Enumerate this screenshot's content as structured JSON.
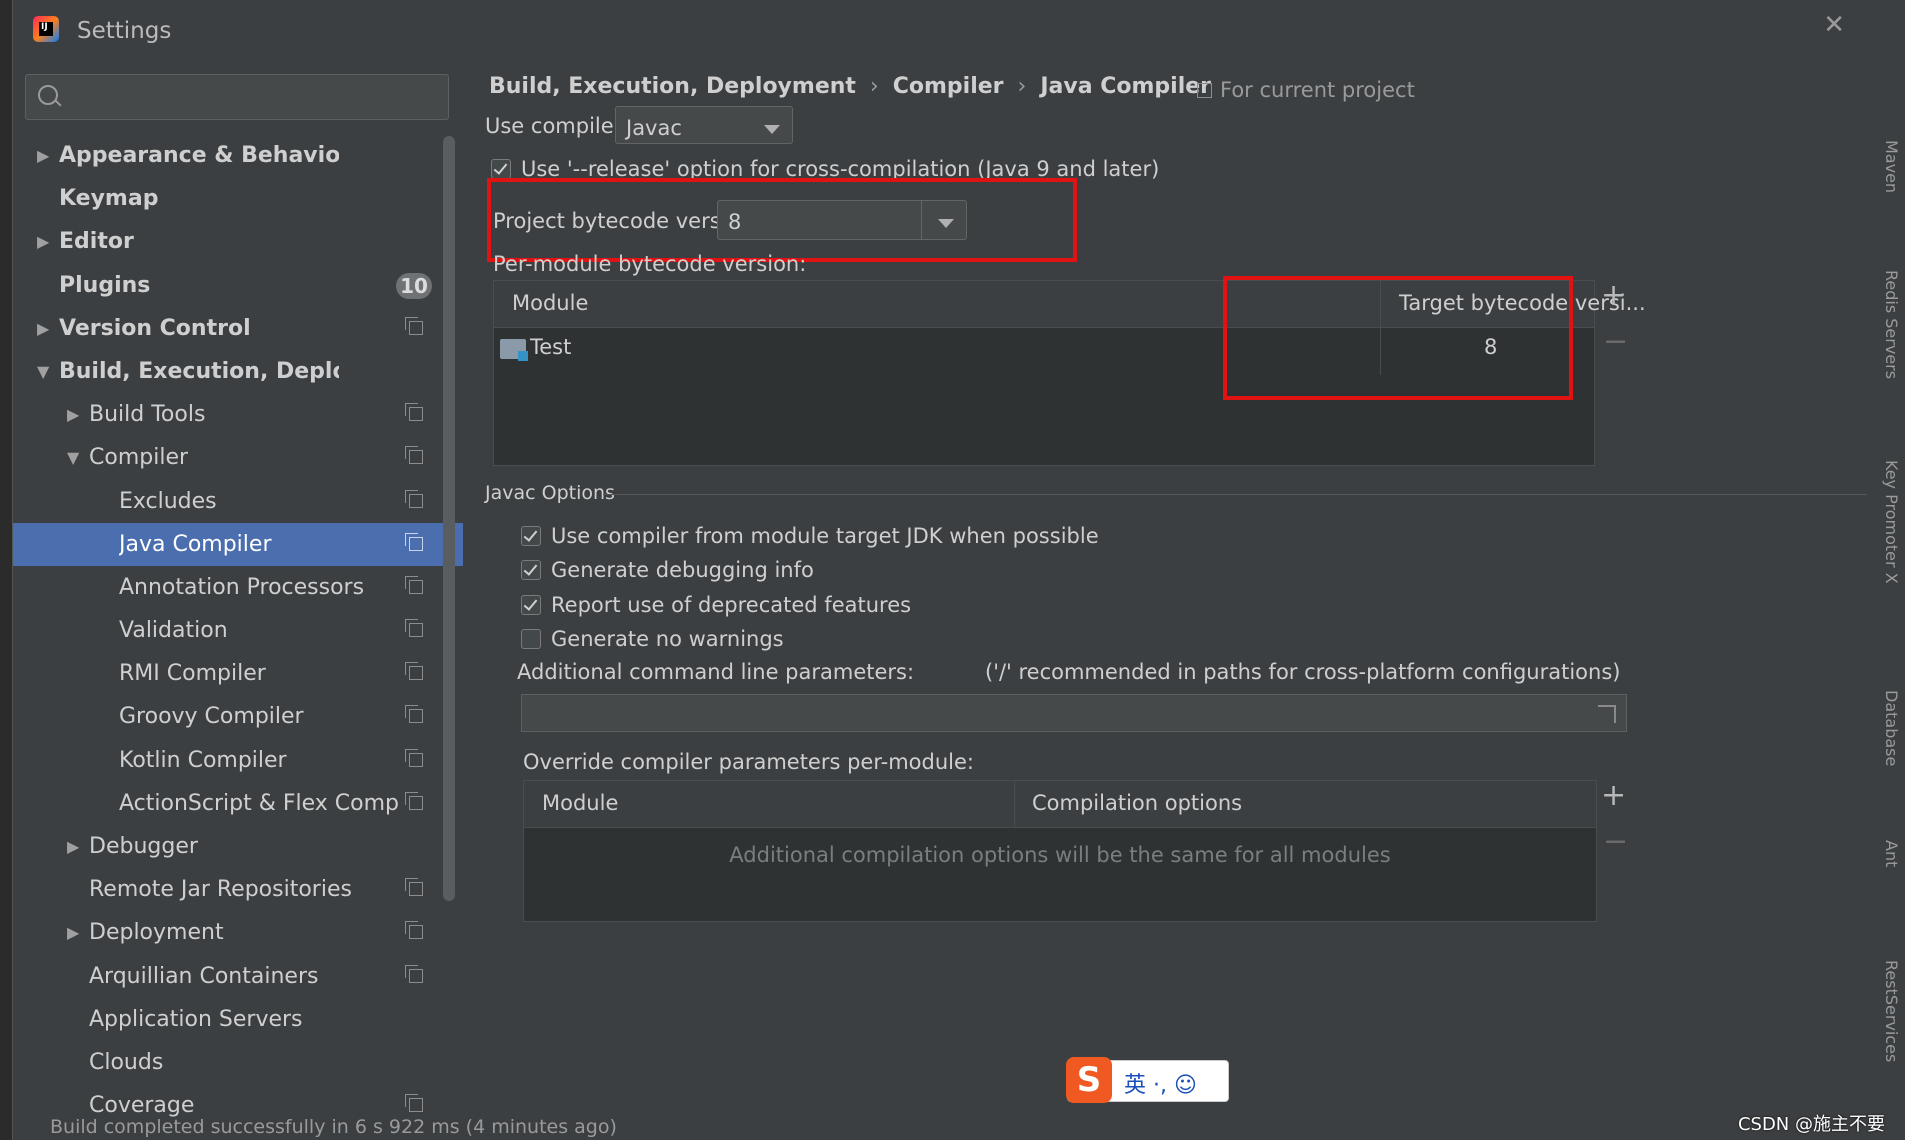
{
  "window": {
    "title": "Settings"
  },
  "search": {
    "placeholder": ""
  },
  "sidebar": {
    "items": [
      {
        "label": "Appearance & Behavior",
        "level": 0,
        "arrow": "collapsed",
        "bold": true
      },
      {
        "label": "Keymap",
        "level": 0,
        "arrow": "none",
        "bold": true
      },
      {
        "label": "Editor",
        "level": 0,
        "arrow": "collapsed",
        "bold": true
      },
      {
        "label": "Plugins",
        "level": 0,
        "arrow": "none",
        "bold": true,
        "badge": "10"
      },
      {
        "label": "Version Control",
        "level": 0,
        "arrow": "collapsed",
        "bold": true,
        "project": true
      },
      {
        "label": "Build, Execution, Deployment",
        "level": 0,
        "arrow": "expanded",
        "bold": true
      },
      {
        "label": "Build Tools",
        "level": 1,
        "arrow": "collapsed",
        "project": true
      },
      {
        "label": "Compiler",
        "level": 1,
        "arrow": "expanded",
        "project": true
      },
      {
        "label": "Excludes",
        "level": 2,
        "arrow": "none",
        "project": true
      },
      {
        "label": "Java Compiler",
        "level": 2,
        "arrow": "none",
        "project": true,
        "selected": true
      },
      {
        "label": "Annotation Processors",
        "level": 2,
        "arrow": "none",
        "project": true
      },
      {
        "label": "Validation",
        "level": 2,
        "arrow": "none",
        "project": true
      },
      {
        "label": "RMI Compiler",
        "level": 2,
        "arrow": "none",
        "project": true
      },
      {
        "label": "Groovy Compiler",
        "level": 2,
        "arrow": "none",
        "project": true
      },
      {
        "label": "Kotlin Compiler",
        "level": 2,
        "arrow": "none",
        "project": true
      },
      {
        "label": "ActionScript & Flex Compiler",
        "level": 2,
        "arrow": "none",
        "project": true
      },
      {
        "label": "Debugger",
        "level": 1,
        "arrow": "collapsed"
      },
      {
        "label": "Remote Jar Repositories",
        "level": 1,
        "arrow": "none",
        "project": true
      },
      {
        "label": "Deployment",
        "level": 1,
        "arrow": "collapsed",
        "project": true
      },
      {
        "label": "Arquillian Containers",
        "level": 1,
        "arrow": "none",
        "project": true
      },
      {
        "label": "Application Servers",
        "level": 1,
        "arrow": "none"
      },
      {
        "label": "Clouds",
        "level": 1,
        "arrow": "none"
      },
      {
        "label": "Coverage",
        "level": 1,
        "arrow": "none",
        "project": true
      }
    ]
  },
  "breadcrumb": {
    "items": [
      "Build, Execution, Deployment",
      "Compiler",
      "Java Compiler"
    ],
    "scope": "For current project"
  },
  "compiler": {
    "label": "Use compiler:",
    "value": "Javac"
  },
  "release_option": {
    "label": "Use '--release' option for cross-compilation (Java 9 and later)",
    "checked": true
  },
  "project_bytecode": {
    "label": "Project bytecode version:",
    "value": "8"
  },
  "per_module": {
    "label": "Per-module bytecode version:",
    "columns": [
      "Module",
      "Target bytecode versi..."
    ],
    "rows": [
      {
        "module": "Test",
        "target": "8"
      }
    ]
  },
  "javac_options": {
    "title": "Javac Options",
    "checkboxes": [
      {
        "label": "Use compiler from module target JDK when possible",
        "checked": true
      },
      {
        "label": "Generate debugging info",
        "checked": true
      },
      {
        "label": "Report use of deprecated features",
        "checked": true
      },
      {
        "label": "Generate no warnings",
        "checked": false
      }
    ],
    "cmd_label": "Additional command line parameters:",
    "cmd_hint": "('/' recommended in paths for cross-platform configurations)",
    "cmd_value": ""
  },
  "override": {
    "label": "Override compiler parameters per-module:",
    "columns": [
      "Module",
      "Compilation options"
    ],
    "empty_text": "Additional compilation options will be the same for all modules"
  },
  "statusbar": {
    "text": "Build completed successfully in 6 s 922 ms (4 minutes ago)"
  },
  "ime": {
    "logo": "S",
    "text": "英 ·, ☺"
  },
  "watermark": {
    "text": "CSDN @施主不要"
  },
  "right_tools": [
    "Maven",
    "Redis Servers",
    "Key Promoter X",
    "Database",
    "Ant",
    "RestServices"
  ],
  "colors": {
    "selection": "#4b6eaf",
    "highlight": "#e01212",
    "background": "#3c3f41"
  }
}
